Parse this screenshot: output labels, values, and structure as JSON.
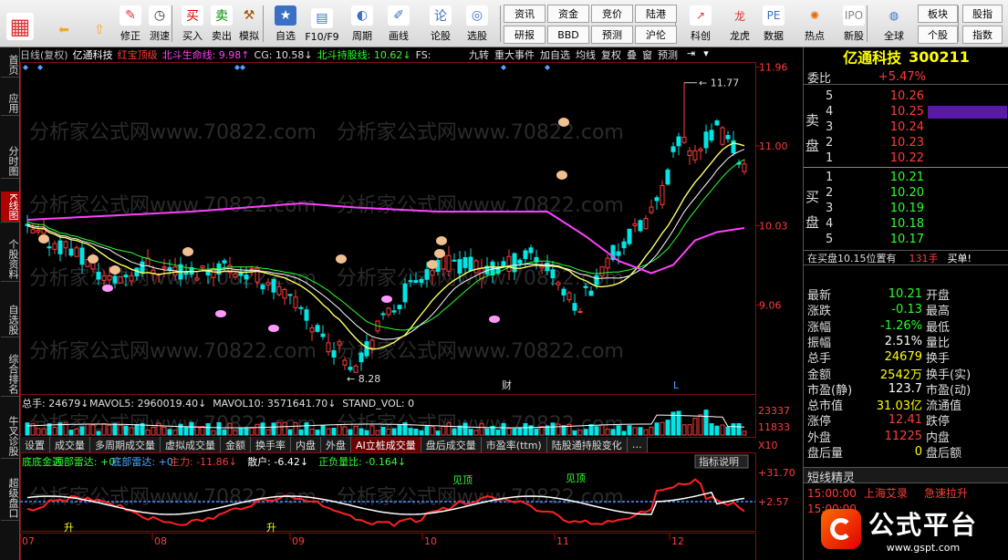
{
  "toolbar": {
    "buttons": [
      {
        "label": "",
        "icon": "grid-icon"
      },
      {
        "label": "",
        "icon": "back-arrow-icon"
      },
      {
        "label": "",
        "icon": "up-arrow-icon"
      },
      {
        "label": "修正",
        "icon": "fix-icon"
      },
      {
        "label": "测速",
        "icon": "clock-icon"
      },
      {
        "label": "买入",
        "icon": "buy-icon"
      },
      {
        "label": "卖出",
        "icon": "sell-icon"
      },
      {
        "label": "模拟",
        "icon": "hammer-icon"
      },
      {
        "label": "自选",
        "icon": "star-icon"
      },
      {
        "label": "F10/F9",
        "icon": "f10-icon"
      },
      {
        "label": "周期",
        "icon": "cycle-icon"
      },
      {
        "label": "画线",
        "icon": "pen-icon"
      },
      {
        "label": "论股",
        "icon": "discuss-icon"
      },
      {
        "label": "选股",
        "icon": "screener-icon"
      }
    ],
    "small_buttons": [
      "资讯",
      "资金",
      "竞价",
      "陆港",
      "研报",
      "BBD",
      "预测",
      "沪伦"
    ],
    "buttons2": [
      {
        "label": "科创",
        "icon": "chart-icon"
      },
      {
        "label": "龙虎",
        "icon": "dragon-icon"
      },
      {
        "label": "数据",
        "icon": "pe-icon"
      },
      {
        "label": "热点",
        "icon": "hot-icon"
      },
      {
        "label": "新股",
        "icon": "ipo-icon"
      },
      {
        "label": "全球",
        "icon": "globe-icon"
      }
    ],
    "small_buttons2": [
      "板块",
      "股指",
      "个股",
      "指数"
    ]
  },
  "leftbar": [
    "首页",
    "应用",
    "分时图",
    "K线图",
    "个股资料",
    "自选股",
    "综合排名",
    "牛叉诊股",
    "超级盘口"
  ],
  "infobar": {
    "items": [
      {
        "text": "日线(复权)",
        "color": "#c0c0c0"
      },
      {
        "text": "亿通科技",
        "color": "#ffffff"
      },
      {
        "text": "红宝顶级",
        "color": "#ff3b3b"
      },
      {
        "text": "北斗生命线: 9.98↑",
        "color": "#ff40ff"
      },
      {
        "text": "CG: 10.58↓",
        "color": "#e0e0e0"
      },
      {
        "text": "北斗持股线: 10.62↓",
        "color": "#2cff2c"
      },
      {
        "text": "FS:",
        "color": "#e0e0e0"
      }
    ],
    "right_buttons": [
      "九转",
      "重大事件",
      "加自选",
      "均线",
      "复权",
      "叠",
      "窗",
      "预测"
    ]
  },
  "price_axis": [
    "11.96",
    "11.00",
    "10.03",
    "9.06"
  ],
  "annotations": {
    "high": "11.77",
    "low": "8.28",
    "cai": "财",
    "l": "L"
  },
  "volume": {
    "header": [
      {
        "text": "总手: 24679↓",
        "color": "#e0e0e0"
      },
      {
        "text": "MAVOL5: 2960019.40↓",
        "color": "#e0e0e0"
      },
      {
        "text": "MAVOL10: 3571641.70↓",
        "color": "#e0e0e0"
      },
      {
        "text": "STAND_VOL: 0",
        "color": "#e0e0e0"
      }
    ],
    "axis": [
      "23337",
      "11833",
      "X10"
    ]
  },
  "tabs": [
    "设置",
    "成交量",
    "多周期成交量",
    "虚拟成交量",
    "金额",
    "换手率",
    "内盘",
    "外盘",
    "AI立桩成交量",
    "盘后成交量",
    "市盈率(ttm)",
    "陆股通持股变化",
    "…"
  ],
  "active_tab": 8,
  "indicator": {
    "header": [
      {
        "text": "底底金达",
        "color": "#2cff2c"
      },
      {
        "text": "顶部雷达: +0",
        "color": "#2cff2c"
      },
      {
        "text": "底部雷达: +0",
        "color": "#4da6ff"
      },
      {
        "text": "主力: -11.86↓",
        "color": "#ff3b3b"
      },
      {
        "text": "散户: -6.42↓",
        "color": "#ffffff"
      },
      {
        "text": "正负量比: -0.164↓",
        "color": "#2cff2c"
      }
    ],
    "help": "指标说明",
    "axis": [
      "+31.70",
      "+2.57"
    ],
    "labels": [
      "见顶",
      "见顶",
      "升",
      "升"
    ]
  },
  "dates": [
    "07",
    "08",
    "09",
    "10",
    "11",
    "12"
  ],
  "stock": {
    "name": "亿通科技",
    "code": "300211"
  },
  "orderbook": {
    "wei_bi_label": "委比",
    "wei_bi": "+5.47%",
    "sell_label": "卖盘",
    "buy_label": "买盘",
    "sell": [
      {
        "lvl": "5",
        "price": "10.26"
      },
      {
        "lvl": "4",
        "price": "10.25"
      },
      {
        "lvl": "3",
        "price": "10.24"
      },
      {
        "lvl": "2",
        "price": "10.23"
      },
      {
        "lvl": "1",
        "price": "10.22"
      }
    ],
    "buy": [
      {
        "lvl": "1",
        "price": "10.21"
      },
      {
        "lvl": "2",
        "price": "10.20"
      },
      {
        "lvl": "3",
        "price": "10.19"
      },
      {
        "lvl": "4",
        "price": "10.18"
      },
      {
        "lvl": "5",
        "price": "10.17"
      }
    ],
    "position_text": "在买盘10.15位置有",
    "position_vol": "131手",
    "position_tag": "买单!"
  },
  "quote_rows": [
    {
      "l": "最新",
      "v": "10.21",
      "vc": "#2cff2c",
      "r": "开盘"
    },
    {
      "l": "涨跌",
      "v": "-0.13",
      "vc": "#2cff2c",
      "r": "最高"
    },
    {
      "l": "涨幅",
      "v": "-1.26%",
      "vc": "#2cff2c",
      "r": "最低"
    },
    {
      "l": "振幅",
      "v": "2.51%",
      "vc": "#ffffff",
      "r": "量比"
    },
    {
      "l": "总手",
      "v": "24679",
      "vc": "#ffff00",
      "r": "换手"
    },
    {
      "l": "金额",
      "v": "2542万",
      "vc": "#ffff00",
      "r": "换手(实)"
    },
    {
      "l": "市盈(静)",
      "v": "123.7",
      "vc": "#ffffff",
      "r": "市盈(动)"
    },
    {
      "l": "总市值",
      "v": "31.03亿",
      "vc": "#ffff00",
      "r": "流通值"
    },
    {
      "l": "涨停",
      "v": "12.41",
      "vc": "#ff3b3b",
      "r": "跌停"
    },
    {
      "l": "外盘",
      "v": "11225",
      "vc": "#ff3b3b",
      "r": "内盘"
    },
    {
      "l": "盘后量",
      "v": "0",
      "vc": "#ffff00",
      "r": "盘后额"
    }
  ],
  "spirit": {
    "title": "短线精灵",
    "rows": [
      {
        "time": "15:00:00",
        "name": "上海艾录",
        "event": "急速拉升"
      },
      {
        "time": "15:00:00",
        "name": "",
        "event": ""
      }
    ]
  },
  "logo": {
    "text": "公式平台",
    "url": "www.gspt.com"
  },
  "colors": {
    "up": "#ff3b3b",
    "down": "#00e5e5",
    "ma_yellow": "#ffff66",
    "ma_magenta": "#ff40ff"
  }
}
